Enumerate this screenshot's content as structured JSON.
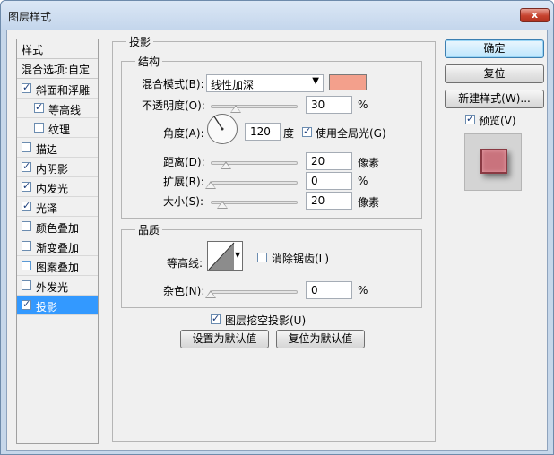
{
  "window": {
    "title": "图层样式",
    "close_glyph": "x"
  },
  "style_list": {
    "header": "样式",
    "blend_options": "混合选项:自定",
    "items": [
      {
        "label": "斜面和浮雕",
        "checked": true
      },
      {
        "label": "等高线",
        "checked": true
      },
      {
        "label": "纹理",
        "checked": false
      },
      {
        "label": "描边",
        "checked": false
      },
      {
        "label": "内阴影",
        "checked": true
      },
      {
        "label": "内发光",
        "checked": true
      },
      {
        "label": "光泽",
        "checked": true
      },
      {
        "label": "颜色叠加",
        "checked": false
      },
      {
        "label": "渐变叠加",
        "checked": false
      },
      {
        "label": "图案叠加",
        "checked": false
      },
      {
        "label": "外发光",
        "checked": false
      },
      {
        "label": "投影",
        "checked": true,
        "selected": true
      }
    ]
  },
  "panel": {
    "title": "投影",
    "structure": {
      "title": "结构",
      "blend_mode_label": "混合模式(B):",
      "blend_mode_value": "线性加深",
      "blend_color": "#f3a08c",
      "opacity_label": "不透明度(O):",
      "opacity_value": "30",
      "opacity_unit": "%",
      "opacity_level": 30,
      "angle_label": "角度(A):",
      "angle_value": "120",
      "angle_unit": "度",
      "global_light_label": "使用全局光(G)",
      "distance_label": "距离(D):",
      "distance_value": "20",
      "distance_unit": "像素",
      "spread_label": "扩展(R):",
      "spread_value": "0",
      "spread_unit": "%",
      "size_label": "大小(S):",
      "size_value": "20",
      "size_unit": "像素"
    },
    "quality": {
      "title": "品质",
      "contour_label": "等高线:",
      "antialias_label": "消除锯齿(L)",
      "noise_label": "杂色(N):",
      "noise_value": "0",
      "noise_unit": "%"
    },
    "knockout_label": "图层挖空投影(U)",
    "make_default": "设置为默认值",
    "reset_default": "复位为默认值"
  },
  "buttons": {
    "ok": "确定",
    "reset": "复位",
    "new_style": "新建样式(W)...",
    "preview_label": "预览(V)"
  }
}
